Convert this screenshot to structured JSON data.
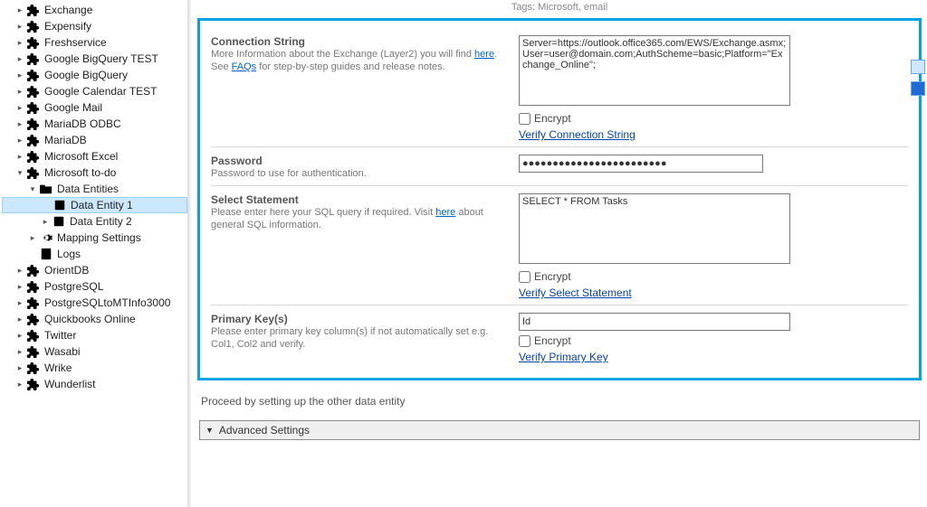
{
  "tags_line": "Tags: Microsoft, email",
  "tree": [
    {
      "indent": 1,
      "exp": ">",
      "icon": "puzzle",
      "label": "Exchange"
    },
    {
      "indent": 1,
      "exp": ">",
      "icon": "puzzle",
      "label": "Expensify"
    },
    {
      "indent": 1,
      "exp": ">",
      "icon": "puzzle",
      "label": "Freshservice"
    },
    {
      "indent": 1,
      "exp": ">",
      "icon": "puzzle",
      "label": "Google BigQuery TEST"
    },
    {
      "indent": 1,
      "exp": ">",
      "icon": "puzzle",
      "label": "Google BigQuery"
    },
    {
      "indent": 1,
      "exp": ">",
      "icon": "puzzle",
      "label": "Google Calendar TEST"
    },
    {
      "indent": 1,
      "exp": ">",
      "icon": "puzzle",
      "label": "Google Mail"
    },
    {
      "indent": 1,
      "exp": ">",
      "icon": "puzzle",
      "label": "MariaDB ODBC"
    },
    {
      "indent": 1,
      "exp": ">",
      "icon": "puzzle",
      "label": "MariaDB"
    },
    {
      "indent": 1,
      "exp": ">",
      "icon": "puzzle",
      "label": "Microsoft Excel"
    },
    {
      "indent": 1,
      "exp": "v",
      "icon": "puzzle",
      "label": "Microsoft to-do"
    },
    {
      "indent": 2,
      "exp": "v",
      "icon": "folder",
      "label": "Data Entities"
    },
    {
      "indent": 3,
      "exp": " ",
      "icon": "datasheet",
      "label": "Data Entity 1",
      "selected": true
    },
    {
      "indent": 3,
      "exp": ">",
      "icon": "datasheet",
      "label": "Data Entity 2"
    },
    {
      "indent": 2,
      "exp": ">",
      "icon": "gear",
      "label": "Mapping Settings"
    },
    {
      "indent": 2,
      "exp": " ",
      "icon": "log",
      "label": "Logs"
    },
    {
      "indent": 1,
      "exp": ">",
      "icon": "puzzle",
      "label": "OrientDB"
    },
    {
      "indent": 1,
      "exp": ">",
      "icon": "puzzle",
      "label": "PostgreSQL"
    },
    {
      "indent": 1,
      "exp": ">",
      "icon": "puzzle",
      "label": "PostgreSQLtoMTInfo3000"
    },
    {
      "indent": 1,
      "exp": ">",
      "icon": "puzzle",
      "label": "Quickbooks Online"
    },
    {
      "indent": 1,
      "exp": ">",
      "icon": "puzzle",
      "label": "Twitter"
    },
    {
      "indent": 1,
      "exp": ">",
      "icon": "puzzle",
      "label": "Wasabi"
    },
    {
      "indent": 1,
      "exp": ">",
      "icon": "puzzle",
      "label": "Wrike"
    },
    {
      "indent": 1,
      "exp": ">",
      "icon": "puzzle",
      "label": "Wunderlist"
    }
  ],
  "conn": {
    "title": "Connection String",
    "desc_pre": "More Information about the Exchange (Layer2) you will find ",
    "desc_here": "here",
    "desc_mid": ". See ",
    "desc_faqs": "FAQs",
    "desc_post": " for step-by-step guides and release notes.",
    "value": "Server=https://outlook.office365.com/EWS/Exchange.asmx;User=user@domain.com;AuthScheme=basic;Platform=\"Exchange_Online\";",
    "encrypt_label": "Encrypt",
    "verify_link": "Verify Connection String"
  },
  "pwd": {
    "title": "Password",
    "desc": "Password to use for authentication.",
    "value": "●●●●●●●●●●●●●●●●●●●●●●●●"
  },
  "select": {
    "title": "Select Statement",
    "desc_pre": "Please enter here your SQL query if required. Visit ",
    "desc_here": "here",
    "desc_post": " about general SQL information.",
    "value": "SELECT * FROM Tasks",
    "encrypt_label": "Encrypt",
    "verify_link": "Verify Select Statement"
  },
  "pkey": {
    "title": "Primary Key(s)",
    "desc": "Please enter primary key column(s) if not automatically set e.g. Col1, Col2 and verify.",
    "value": "Id",
    "encrypt_label": "Encrypt",
    "verify_link": "Verify Primary Key"
  },
  "proceed_hint": "Proceed by setting up the other data entity",
  "advanced_label": "Advanced Settings"
}
